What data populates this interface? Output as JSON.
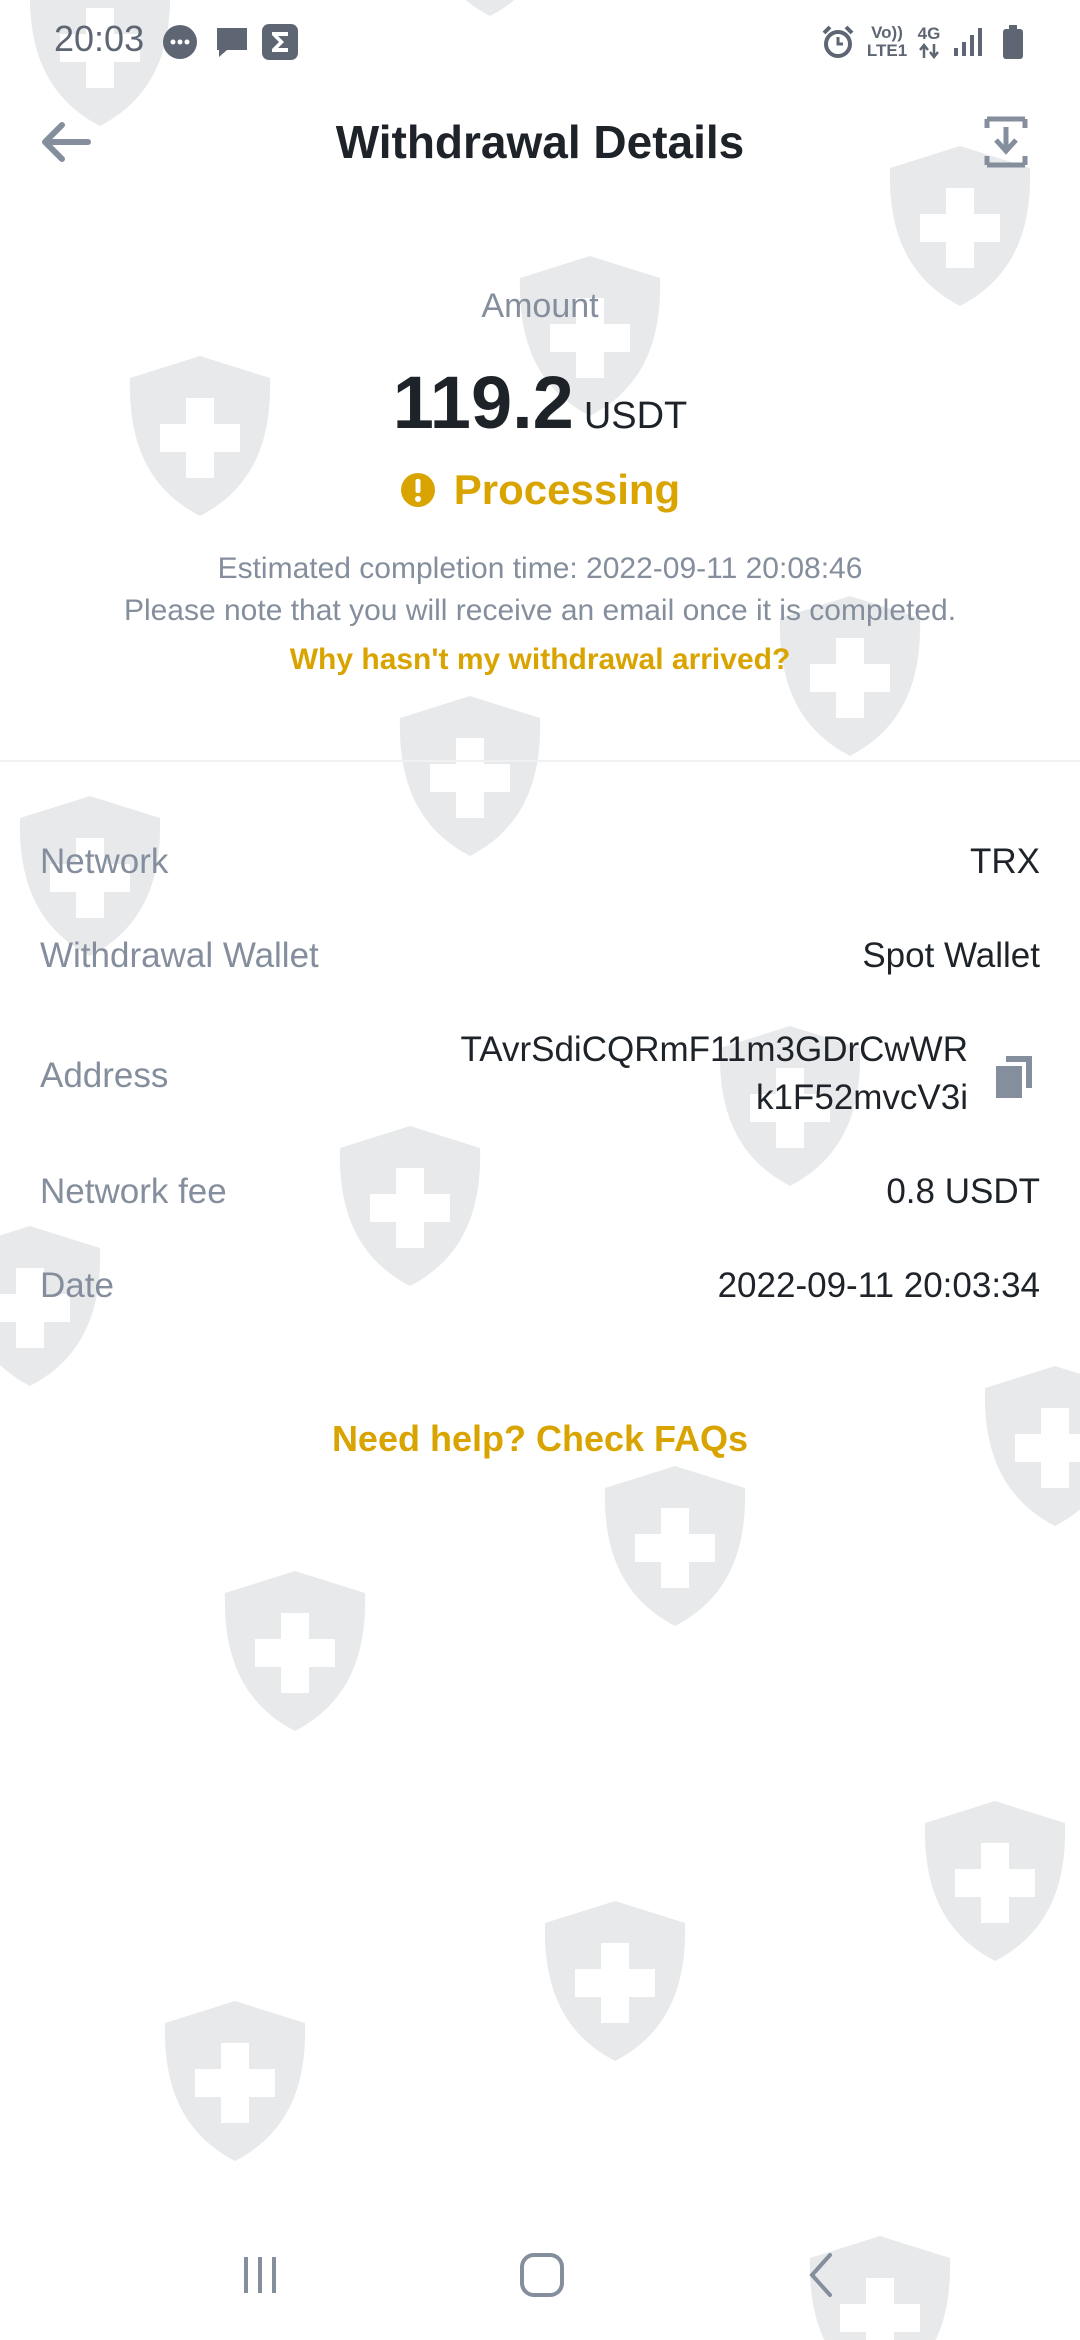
{
  "status_bar": {
    "time": "20:03",
    "network_vo": "Vo))",
    "network_lte": "LTE1",
    "network_4g": "4G"
  },
  "header": {
    "title": "Withdrawal Details"
  },
  "summary": {
    "amount_label": "Amount",
    "amount_value": "119.2",
    "amount_unit": "USDT",
    "status": "Processing",
    "status_color": "#d9a400",
    "eta": "Estimated completion time: 2022-09-11 20:08:46",
    "note": "Please note that you will receive an email once it is completed.",
    "why_link": "Why hasn't my withdrawal arrived?"
  },
  "details": {
    "network": {
      "label": "Network",
      "value": "TRX"
    },
    "wallet": {
      "label": "Withdrawal Wallet",
      "value": "Spot Wallet"
    },
    "address": {
      "label": "Address",
      "line1": "TAvrSdiCQRmF11m3GDrCwWR",
      "line2": "k1F52mvcV3i"
    },
    "fee": {
      "label": "Network fee",
      "value": "0.8 USDT"
    },
    "date": {
      "label": "Date",
      "value": "2022-09-11 20:03:34"
    }
  },
  "faq_link": "Need help? Check FAQs",
  "colors": {
    "accent": "#d9a400",
    "text_primary": "#1e2329",
    "text_secondary": "#848e9c"
  },
  "icons": {
    "back": "arrow-left-icon",
    "download": "download-icon",
    "status": "exclamation-circle-icon",
    "copy": "copy-icon",
    "watermark": "shield-plus-icon"
  }
}
